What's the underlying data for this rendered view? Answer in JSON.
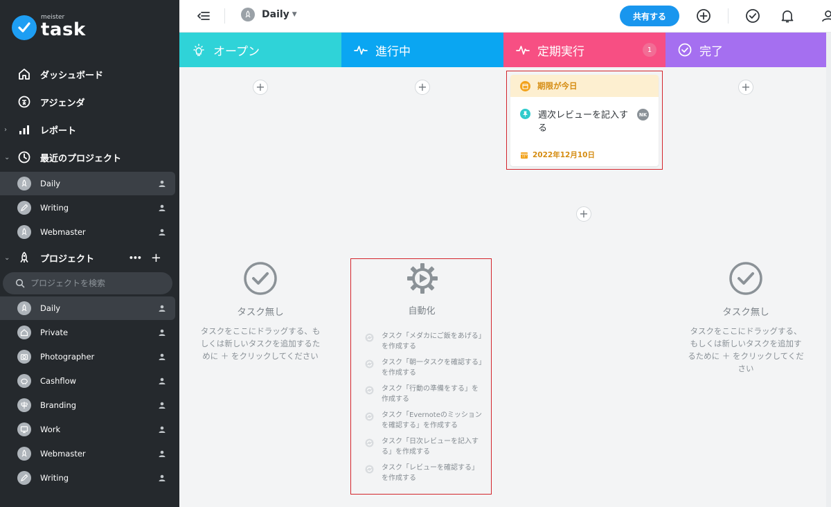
{
  "logo": {
    "small": "meister",
    "big": "task"
  },
  "nav": {
    "dashboard": "ダッシュボード",
    "agenda": "アジェンダ",
    "reports": "レポート",
    "recent_projects": "最近のプロジェクト",
    "projects": "プロジェクト",
    "projects_more": "•••",
    "projects_add": "+"
  },
  "recent": [
    {
      "name": "Daily",
      "icon": "rocket-icon"
    },
    {
      "name": "Writing",
      "icon": "pencil-icon"
    },
    {
      "name": "Webmaster",
      "icon": "rocket-icon"
    }
  ],
  "search": {
    "placeholder": "プロジェクトを検索"
  },
  "projects": [
    {
      "name": "Daily",
      "icon": "rocket-icon"
    },
    {
      "name": "Private",
      "icon": "house-icon"
    },
    {
      "name": "Photographer",
      "icon": "camera-icon"
    },
    {
      "name": "Cashflow",
      "icon": "piggy-bank-icon"
    },
    {
      "name": "Branding",
      "icon": "signpost-icon"
    },
    {
      "name": "Work",
      "icon": "monitor-icon"
    },
    {
      "name": "Webmaster",
      "icon": "rocket-icon"
    },
    {
      "name": "Writing",
      "icon": "pencil-icon"
    }
  ],
  "header": {
    "project": "Daily",
    "share": "共有する"
  },
  "columns": {
    "open": {
      "title": "オープン",
      "color": "#2fd3d8"
    },
    "in_progress": {
      "title": "進行中",
      "color": "#0aa6f2"
    },
    "recurring": {
      "title": "定期実行",
      "color": "#f74f83",
      "count": "1"
    },
    "done": {
      "title": "完了",
      "color": "#a56ff0"
    }
  },
  "empty": {
    "title": "タスク無し",
    "desc": "タスクをここにドラッグする、もしくは新しいタスクを追加するために ＋ をクリックしてください"
  },
  "automation": {
    "title": "自動化",
    "items": [
      "タスク「メダカにご飯をあげる」を作成する",
      "タスク「朝一タスクを確認する」を作成する",
      "タスク「行動の準備をする」を作成する",
      "タスク「Evernoteのミッションを確認する」を作成する",
      "タスク「日次レビューを記入する」を作成する",
      "タスク「レビューを確認する」を作成する"
    ]
  },
  "task": {
    "due_label": "期限が今日",
    "title": "週次レビューを記入する",
    "assignee": "NK",
    "date": "2022年12月10日"
  }
}
